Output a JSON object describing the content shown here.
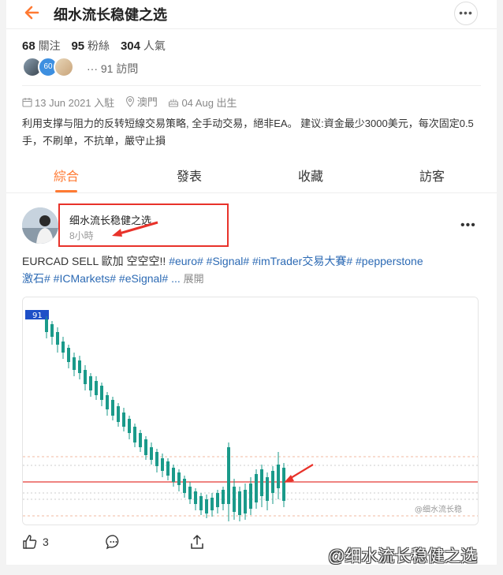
{
  "header": {
    "title": "细水流长稳健之选",
    "more_label": "•••"
  },
  "stats": {
    "following_count": "68",
    "following_label": "關注",
    "fans_count": "95",
    "fans_label": "粉絲",
    "popularity_count": "304",
    "popularity_label": "人氣"
  },
  "visitors": {
    "badge": "60",
    "text": "··· 91 訪問"
  },
  "meta": {
    "joined": "13 Jun 2021 入駐",
    "location": "澳門",
    "birthday": "04 Aug 出生"
  },
  "bio": "利用支撑与阻力的反转短線交易策略, 全手动交易，絕非EA。 建议:資金最少3000美元，每次固定0.5手，不刷单，不抗单，嚴守止損",
  "tabs": [
    {
      "label": "綜合"
    },
    {
      "label": "發表"
    },
    {
      "label": "收藏"
    },
    {
      "label": "訪客"
    }
  ],
  "post": {
    "author": "细水流长稳健之选",
    "time": "8小時",
    "text_plain": "EURCAD SELL 歐加 空空空!! ",
    "tags_line1": "#euro# #Signal# #imTrader交易大賽# #pepperstone",
    "tags_line2": "激石# #ICMarkets# #eSignal# ...",
    "expand_label": "展開",
    "chart_badge": "91",
    "chart_watermark": "@细水流长稳",
    "likes": "3"
  },
  "watermark": "@细水流长稳健之选",
  "colors": {
    "accent": "#ff7a33",
    "tag": "#2c6ab4",
    "annotation": "#e8322a",
    "candle": "#1a9a8a"
  },
  "chart_data": {
    "type": "candlestick",
    "candles": []
  }
}
